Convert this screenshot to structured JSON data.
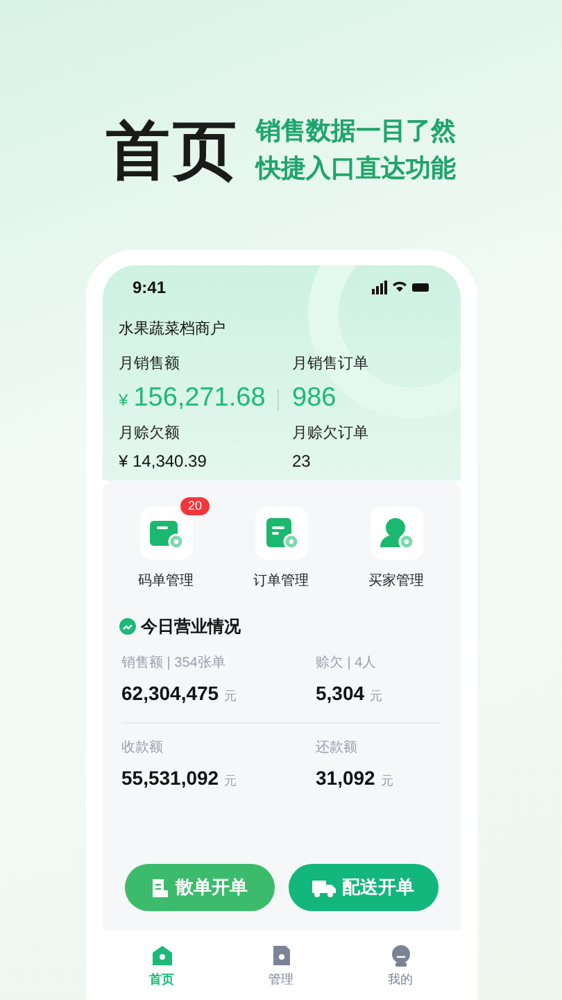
{
  "hero": {
    "title": "首页",
    "subtitle_lines": [
      "销售数据一目了然",
      "快捷入口直达功能"
    ]
  },
  "status_bar": {
    "time": "9:41"
  },
  "merchant": "水果蔬菜档商户",
  "monthly_primary": [
    {
      "label": "月销售额",
      "currency": "¥",
      "value": "156,271.68"
    },
    {
      "label": "月销售订单",
      "value": "986"
    }
  ],
  "monthly_secondary": [
    {
      "label": "月赊欠额",
      "value": "¥ 14,340.39"
    },
    {
      "label": "月赊欠订单",
      "value": "23"
    }
  ],
  "shortcuts": [
    {
      "label": "码单管理",
      "badge": "20"
    },
    {
      "label": "订单管理"
    },
    {
      "label": "买家管理"
    }
  ],
  "today": {
    "title": "今日营业情况",
    "stats": [
      {
        "label": "销售额 | 354张单",
        "value": "62,304,475",
        "unit": "元"
      },
      {
        "label": "赊欠 | 4人",
        "value": "5,304",
        "unit": "元"
      },
      {
        "label": "收款额",
        "value": "55,531,092",
        "unit": "元"
      },
      {
        "label": "还款额",
        "value": "31,092",
        "unit": "元"
      }
    ]
  },
  "actions": [
    {
      "label": "散单开单",
      "color": "#3dbb6c"
    },
    {
      "label": "配送开单",
      "color": "#13b67c"
    }
  ],
  "tab_bar": [
    {
      "label": "首页",
      "selected": true
    },
    {
      "label": "管理",
      "selected": false
    },
    {
      "label": "我的",
      "selected": false
    }
  ]
}
